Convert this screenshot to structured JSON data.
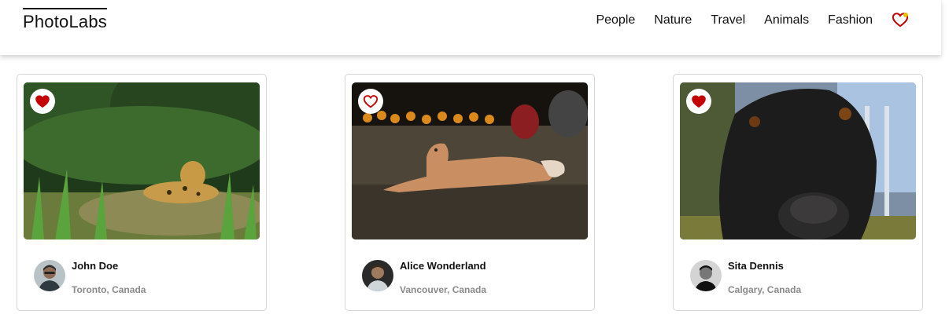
{
  "app": {
    "logo": "PhotoLabs"
  },
  "nav": {
    "items": [
      "People",
      "Nature",
      "Travel",
      "Animals",
      "Fashion"
    ],
    "favorites_icon": "heart-outline-icon",
    "favorites_notification": true
  },
  "colors": {
    "heart_red": "#c40000",
    "notification": "#e8c000"
  },
  "photos": [
    {
      "subject": "jaguar",
      "favorited": true,
      "favorite_icon": "heart-filled-icon",
      "author": {
        "name": "John Doe",
        "location": "Toronto, Canada"
      }
    },
    {
      "subject": "dog-lying",
      "favorited": false,
      "favorite_icon": "heart-outline-icon",
      "author": {
        "name": "Alice Wonderland",
        "location": "Vancouver, Canada"
      }
    },
    {
      "subject": "black-dog",
      "favorited": true,
      "favorite_icon": "heart-filled-icon",
      "author": {
        "name": "Sita Dennis",
        "location": "Calgary, Canada"
      }
    }
  ]
}
